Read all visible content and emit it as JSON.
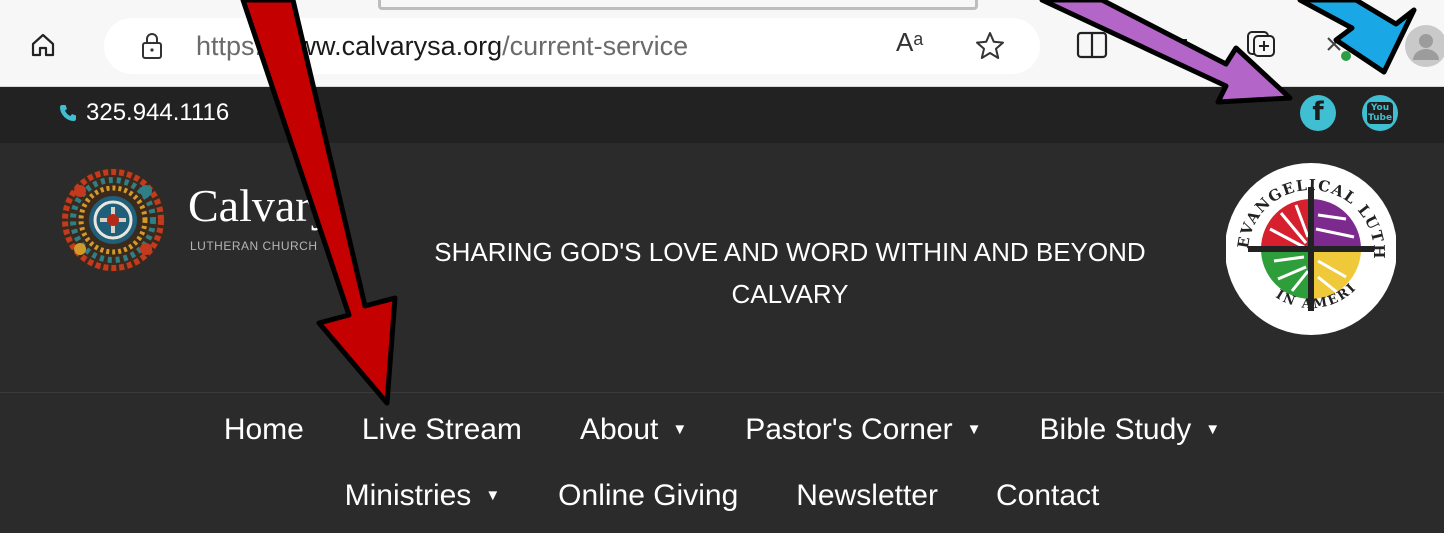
{
  "browser": {
    "url_protocol": "https",
    "url_sep": "://",
    "url_domain": "www.calvarysa.org",
    "url_path": "/current-service",
    "read_aloud_label": "Aᵃ"
  },
  "topbar": {
    "phone": "325.944.1116",
    "facebook_label": "f",
    "youtube_label": "You Tube"
  },
  "header": {
    "logo_name": "Calvary",
    "logo_sub": "LUTHERAN CHURCH",
    "tagline": "SHARING GOD'S LOVE AND WORD WITHIN AND BEYOND CALVARY",
    "elca_ring_top": "EVANGELICAL LUTHERAN CHURCH",
    "elca_ring_bottom": "IN AMERICA"
  },
  "nav": {
    "row1": [
      {
        "label": "Home",
        "dropdown": false
      },
      {
        "label": "Live Stream",
        "dropdown": false
      },
      {
        "label": "About",
        "dropdown": true
      },
      {
        "label": "Pastor's Corner",
        "dropdown": true
      },
      {
        "label": "Bible Study",
        "dropdown": true
      }
    ],
    "row2": [
      {
        "label": "Ministries",
        "dropdown": true
      },
      {
        "label": "Online Giving",
        "dropdown": false
      },
      {
        "label": "Newsletter",
        "dropdown": false
      },
      {
        "label": "Contact",
        "dropdown": false
      }
    ],
    "caret": "▼"
  },
  "colors": {
    "accent": "#3fbfd1",
    "arrow_red": "#c40000",
    "arrow_purple": "#b366c8",
    "arrow_blue": "#1aa7e6"
  },
  "icons": [
    "home-icon",
    "lock-icon",
    "read-aloud-icon",
    "favorite-star-icon",
    "split-screen-icon",
    "extensions-icon",
    "collections-icon",
    "profile-icon",
    "phone-icon",
    "facebook-icon",
    "youtube-icon"
  ]
}
